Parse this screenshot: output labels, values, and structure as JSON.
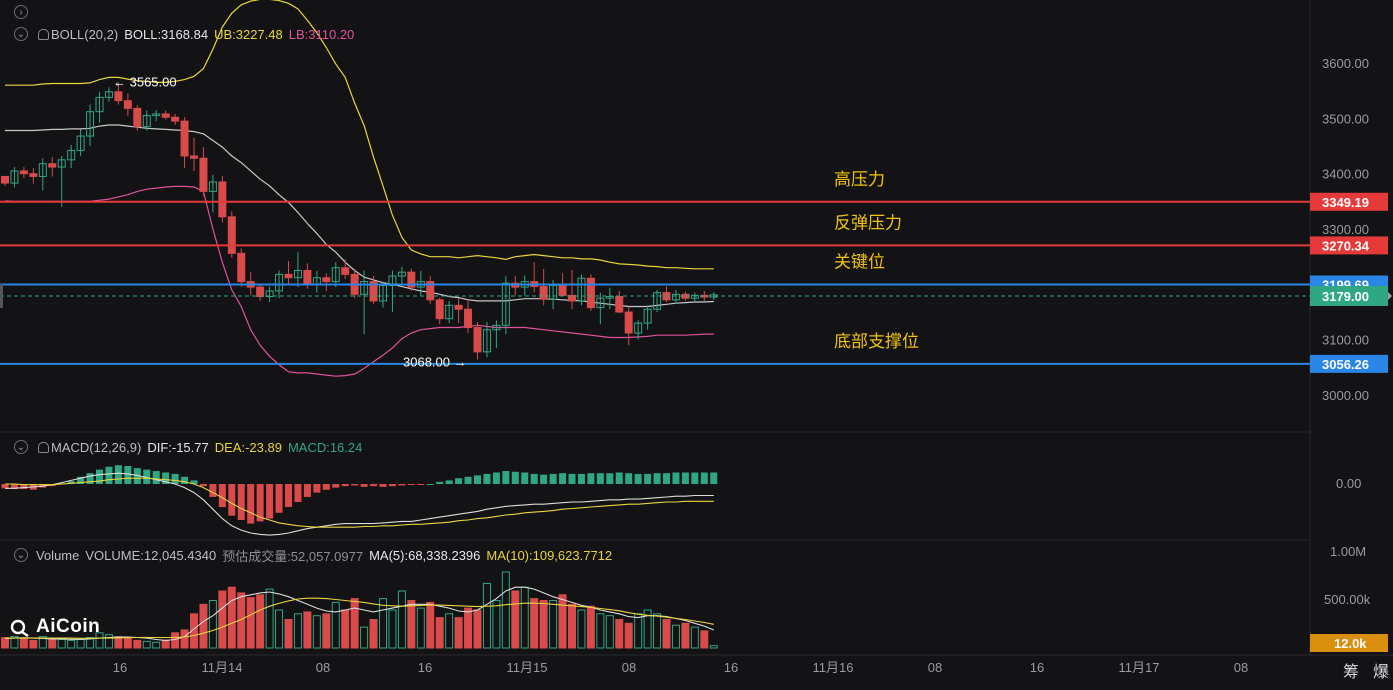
{
  "colors": {
    "background": "#131316",
    "up": "#2fa783",
    "down": "#d94a4a",
    "boll_ub": "#e8d53b",
    "boll_lb": "#e0529c",
    "boll_mid": "#c9c9c9",
    "resistance": "#e43a3a",
    "support": "#2a86e6",
    "current_price": "#2fa783",
    "annotation": "#f0c30e",
    "volume_label_bg": "#d98e0e"
  },
  "header": {
    "chevron_icon": "chevron-right-icon",
    "boll": {
      "label": "BOLL(20,2)",
      "value": "BOLL:3168.84",
      "ub": "UB:3227.48",
      "lb": "LB:3110.20"
    },
    "macd": {
      "label": "MACD(12,26,9)",
      "dif": "DIF:-15.77",
      "dea": "DEA:-23.89",
      "macd": "MACD:16.24"
    },
    "volume": {
      "label": "Volume",
      "volume": "VOLUME:12,045.4340",
      "estimated": "预估成交量:52,057.0977",
      "ma5": "MA(5):68,338.2396",
      "ma10": "MA(10):109,623.7712"
    }
  },
  "logo": {
    "text": "AiCoin"
  },
  "bottom_buttons": [
    "筹",
    "爆"
  ],
  "chart_data": {
    "type": "candlestick",
    "symbol_precision": 2,
    "price_axis": {
      "ticks": [
        3000,
        3100,
        3200,
        3300,
        3400,
        3500,
        3600
      ],
      "tick_labels": [
        "3000.00",
        "3100.00",
        "3200.00",
        "3300.00",
        "3400.00",
        "3500.00",
        "3600.00"
      ],
      "range": [
        2942,
        3642
      ]
    },
    "x_axis": {
      "tick_labels": [
        "16",
        "11月14",
        "08",
        "16",
        "11月15",
        "08",
        "16",
        "11月16",
        "08",
        "16",
        "11月17",
        "08"
      ]
    },
    "candles": [
      [
        3395,
        3395,
        3378,
        3383
      ],
      [
        3383,
        3412,
        3375,
        3405
      ],
      [
        3405,
        3412,
        3392,
        3400
      ],
      [
        3400,
        3410,
        3382,
        3395
      ],
      [
        3395,
        3428,
        3370,
        3418
      ],
      [
        3418,
        3430,
        3395,
        3412
      ],
      [
        3412,
        3432,
        3340,
        3425
      ],
      [
        3425,
        3452,
        3410,
        3442
      ],
      [
        3442,
        3480,
        3432,
        3468
      ],
      [
        3468,
        3525,
        3450,
        3512
      ],
      [
        3512,
        3548,
        3492,
        3538
      ],
      [
        3538,
        3556,
        3530,
        3548
      ],
      [
        3548,
        3565,
        3525,
        3532
      ],
      [
        3532,
        3545,
        3505,
        3518
      ],
      [
        3518,
        3524,
        3478,
        3485
      ],
      [
        3485,
        3514,
        3478,
        3505
      ],
      [
        3505,
        3515,
        3495,
        3508
      ],
      [
        3508,
        3514,
        3498,
        3502
      ],
      [
        3502,
        3508,
        3488,
        3495
      ],
      [
        3495,
        3502,
        3410,
        3432
      ],
      [
        3432,
        3465,
        3405,
        3428
      ],
      [
        3428,
        3448,
        3360,
        3368
      ],
      [
        3368,
        3398,
        3330,
        3385
      ],
      [
        3385,
        3396,
        3312,
        3322
      ],
      [
        3322,
        3332,
        3248,
        3256
      ],
      [
        3256,
        3265,
        3196,
        3205
      ],
      [
        3205,
        3222,
        3180,
        3195
      ],
      [
        3195,
        3200,
        3170,
        3178
      ],
      [
        3178,
        3196,
        3168,
        3188
      ],
      [
        3188,
        3225,
        3175,
        3218
      ],
      [
        3218,
        3242,
        3198,
        3212
      ],
      [
        3212,
        3258,
        3195,
        3225
      ],
      [
        3225,
        3238,
        3192,
        3199
      ],
      [
        3199,
        3224,
        3185,
        3212
      ],
      [
        3212,
        3220,
        3188,
        3205
      ],
      [
        3205,
        3240,
        3195,
        3230
      ],
      [
        3230,
        3245,
        3210,
        3218
      ],
      [
        3218,
        3228,
        3175,
        3182
      ],
      [
        3182,
        3225,
        3110,
        3205
      ],
      [
        3205,
        3215,
        3165,
        3170
      ],
      [
        3170,
        3205,
        3158,
        3198
      ],
      [
        3198,
        3225,
        3150,
        3215
      ],
      [
        3215,
        3232,
        3200,
        3222
      ],
      [
        3222,
        3228,
        3188,
        3195
      ],
      [
        3195,
        3224,
        3180,
        3205
      ],
      [
        3205,
        3215,
        3165,
        3172
      ],
      [
        3172,
        3176,
        3128,
        3138
      ],
      [
        3138,
        3170,
        3130,
        3162
      ],
      [
        3162,
        3175,
        3130,
        3155
      ],
      [
        3155,
        3170,
        3112,
        3122
      ],
      [
        3122,
        3132,
        3064,
        3078
      ],
      [
        3078,
        3132,
        3068,
        3118
      ],
      [
        3118,
        3135,
        3085,
        3126
      ],
      [
        3126,
        3215,
        3110,
        3202
      ],
      [
        3202,
        3215,
        3180,
        3195
      ],
      [
        3195,
        3216,
        3180,
        3205
      ],
      [
        3205,
        3240,
        3185,
        3196
      ],
      [
        3196,
        3228,
        3162,
        3173
      ],
      [
        3173,
        3208,
        3155,
        3198
      ],
      [
        3198,
        3220,
        3188,
        3180
      ],
      [
        3180,
        3226,
        3155,
        3170
      ],
      [
        3170,
        3218,
        3162,
        3211
      ],
      [
        3211,
        3218,
        3152,
        3158
      ],
      [
        3158,
        3185,
        3128,
        3175
      ],
      [
        3175,
        3194,
        3155,
        3178
      ],
      [
        3178,
        3188,
        3148,
        3150
      ],
      [
        3150,
        3160,
        3090,
        3112
      ],
      [
        3112,
        3135,
        3100,
        3130
      ],
      [
        3130,
        3162,
        3118,
        3155
      ],
      [
        3155,
        3190,
        3150,
        3185
      ],
      [
        3185,
        3196,
        3168,
        3172
      ],
      [
        3172,
        3190,
        3165,
        3182
      ],
      [
        3182,
        3187,
        3170,
        3175
      ],
      [
        3175,
        3185,
        3168,
        3180
      ],
      [
        3180,
        3188,
        3170,
        3177
      ],
      [
        3177,
        3186,
        3172,
        3181
      ]
    ],
    "boll_ub": [
      3560,
      3560,
      3560,
      3560,
      3562,
      3563,
      3563,
      3563,
      3563,
      3564,
      3570,
      3574,
      3574,
      3571,
      3568,
      3567,
      3565,
      3565,
      3567,
      3570,
      3576,
      3590,
      3625,
      3665,
      3690,
      3705,
      3712,
      3715,
      3715,
      3713,
      3708,
      3698,
      3677,
      3655,
      3628,
      3598,
      3574,
      3528,
      3487,
      3430,
      3378,
      3325,
      3285,
      3262,
      3255,
      3250,
      3250,
      3250,
      3248,
      3250,
      3252,
      3250,
      3248,
      3245,
      3250,
      3252,
      3254,
      3252,
      3250,
      3248,
      3248,
      3246,
      3246,
      3244,
      3240,
      3237,
      3236,
      3235,
      3233,
      3232,
      3230,
      3230,
      3229,
      3228,
      3228,
      3228
    ],
    "boll_mid": [
      3478,
      3478,
      3478,
      3478,
      3479,
      3480,
      3480,
      3481,
      3481,
      3482,
      3486,
      3488,
      3488,
      3486,
      3484,
      3482,
      3481,
      3480,
      3479,
      3478,
      3476,
      3472,
      3460,
      3448,
      3432,
      3420,
      3405,
      3390,
      3378,
      3362,
      3348,
      3330,
      3310,
      3292,
      3272,
      3258,
      3240,
      3225,
      3213,
      3208,
      3203,
      3200,
      3196,
      3192,
      3188,
      3186,
      3182,
      3178,
      3176,
      3172,
      3170,
      3170,
      3170,
      3170,
      3172,
      3174,
      3174,
      3174,
      3173,
      3172,
      3171,
      3170,
      3168,
      3166,
      3164,
      3162,
      3160,
      3160,
      3160,
      3162,
      3164,
      3166,
      3167,
      3168,
      3168,
      3169
    ],
    "boll_lb": [
      3351,
      3350,
      3350,
      3350,
      3350,
      3350,
      3350,
      3350,
      3350,
      3350,
      3352,
      3354,
      3358,
      3362,
      3368,
      3372,
      3374,
      3376,
      3377,
      3377,
      3376,
      3368,
      3300,
      3240,
      3190,
      3160,
      3118,
      3090,
      3070,
      3055,
      3042,
      3040,
      3040,
      3038,
      3036,
      3034,
      3035,
      3038,
      3048,
      3060,
      3072,
      3085,
      3102,
      3112,
      3118,
      3120,
      3122,
      3122,
      3122,
      3124,
      3126,
      3124,
      3122,
      3122,
      3122,
      3122,
      3120,
      3118,
      3116,
      3114,
      3112,
      3110,
      3108,
      3106,
      3104,
      3104,
      3104,
      3105,
      3106,
      3108,
      3108,
      3108,
      3108,
      3109,
      3110,
      3110
    ],
    "annotations": {
      "high_marker": {
        "price": 3565,
        "label": "3565.00"
      },
      "low_marker": {
        "price": 3068,
        "label": "3068.00"
      }
    },
    "levels": [
      {
        "price": 3349.19,
        "label": "3349.19",
        "kind": "resistance",
        "note": "高压力"
      },
      {
        "price": 3270.34,
        "label": "3270.34",
        "kind": "resistance",
        "note": "反弹压力"
      },
      {
        "price": 3199.69,
        "label": "3199.69",
        "kind": "support",
        "note": "关键位"
      },
      {
        "price": 3056.26,
        "label": "3056.26",
        "kind": "support",
        "note": "底部支撑位"
      }
    ],
    "current_price": {
      "price": 3179.0,
      "label": "3179.00"
    },
    "macd": {
      "axis_label": "0.00",
      "hist": [
        -6,
        -7,
        -7,
        -8,
        -5,
        -3,
        1,
        4,
        10,
        15,
        20,
        24,
        26,
        25,
        22,
        20,
        18,
        16,
        14,
        10,
        5,
        -3,
        -18,
        -32,
        -44,
        -50,
        -55,
        -52,
        -48,
        -40,
        -32,
        -25,
        -18,
        -12,
        -8,
        -5,
        -3,
        -2,
        -4,
        -3,
        -4,
        -3,
        -2,
        -1,
        -1,
        0,
        3,
        5,
        8,
        10,
        12,
        14,
        16,
        18,
        17,
        16,
        14,
        13,
        14,
        15,
        14,
        14,
        15,
        15,
        15,
        16,
        15,
        14,
        14,
        15,
        15,
        16,
        16,
        16,
        16,
        16
      ],
      "dif": [
        -6,
        -6,
        -5,
        -4,
        -3,
        -1,
        2,
        5,
        8,
        11,
        13,
        14,
        15,
        14,
        12,
        9,
        6,
        3,
        0,
        -5,
        -12,
        -22,
        -35,
        -48,
        -58,
        -64,
        -68,
        -70,
        -71,
        -70,
        -68,
        -65,
        -62,
        -60,
        -58,
        -56,
        -55,
        -55,
        -55,
        -55,
        -54,
        -53,
        -52,
        -52,
        -50,
        -48,
        -46,
        -44,
        -42,
        -40,
        -38,
        -35,
        -33,
        -31,
        -30,
        -29,
        -28,
        -28,
        -27,
        -26,
        -25,
        -25,
        -24,
        -23,
        -22,
        -22,
        -21,
        -21,
        -20,
        -19,
        -18,
        -17,
        -17,
        -16,
        -16,
        -16
      ],
      "dea": [
        0,
        0,
        -1,
        -1,
        -1,
        -1,
        0,
        1,
        2,
        3,
        4,
        6,
        7,
        8,
        8,
        8,
        7,
        6,
        5,
        3,
        0,
        -5,
        -12,
        -19,
        -27,
        -34,
        -40,
        -46,
        -50,
        -54,
        -56,
        -58,
        -59,
        -60,
        -60,
        -60,
        -60,
        -60,
        -59,
        -59,
        -58,
        -58,
        -57,
        -56,
        -56,
        -55,
        -54,
        -53,
        -51,
        -50,
        -48,
        -47,
        -45,
        -43,
        -42,
        -40,
        -39,
        -38,
        -37,
        -35,
        -34,
        -33,
        -32,
        -31,
        -30,
        -29,
        -28,
        -28,
        -27,
        -26,
        -25,
        -25,
        -24,
        -24,
        -24,
        -24
      ]
    },
    "volume": {
      "tick_labels": [
        "1.00M",
        "500.00k"
      ],
      "current_label": "12.0k",
      "bars": [
        55,
        60,
        50,
        40,
        60,
        50,
        45,
        40,
        45,
        55,
        80,
        70,
        60,
        55,
        40,
        35,
        30,
        42,
        80,
        95,
        180,
        230,
        250,
        300,
        320,
        290,
        265,
        280,
        310,
        200,
        150,
        180,
        190,
        170,
        180,
        240,
        200,
        260,
        110,
        150,
        260,
        200,
        300,
        250,
        210,
        240,
        160,
        180,
        160,
        210,
        200,
        340,
        250,
        400,
        300,
        320,
        260,
        250,
        250,
        280,
        230,
        200,
        220,
        180,
        170,
        150,
        130,
        180,
        200,
        180,
        150,
        120,
        130,
        110,
        90,
        12
      ],
      "ma5": [
        50,
        52,
        54,
        52,
        50,
        48,
        48,
        46,
        46,
        48,
        52,
        55,
        58,
        58,
        55,
        52,
        45,
        40,
        45,
        60,
        100,
        140,
        170,
        210,
        250,
        270,
        280,
        290,
        295,
        285,
        270,
        250,
        230,
        210,
        195,
        190,
        200,
        210,
        200,
        190,
        200,
        210,
        220,
        230,
        230,
        230,
        220,
        210,
        195,
        190,
        200,
        230,
        260,
        300,
        320,
        320,
        310,
        290,
        270,
        255,
        240,
        225,
        215,
        200,
        190,
        180,
        165,
        160,
        170,
        170,
        165,
        155,
        145,
        130,
        115,
        95
      ],
      "ma10": [
        52,
        52,
        52,
        52,
        52,
        52,
        52,
        52,
        51,
        51,
        52,
        52,
        53,
        54,
        55,
        56,
        55,
        55,
        56,
        58,
        66,
        78,
        92,
        110,
        130,
        150,
        175,
        200,
        220,
        235,
        248,
        258,
        262,
        262,
        260,
        255,
        250,
        245,
        240,
        232,
        225,
        222,
        220,
        222,
        224,
        226,
        226,
        224,
        222,
        220,
        218,
        220,
        222,
        228,
        232,
        236,
        236,
        234,
        230,
        226,
        222,
        218,
        214,
        208,
        202,
        196,
        186,
        178,
        172,
        168,
        162,
        156,
        150,
        142,
        134,
        125
      ]
    }
  }
}
